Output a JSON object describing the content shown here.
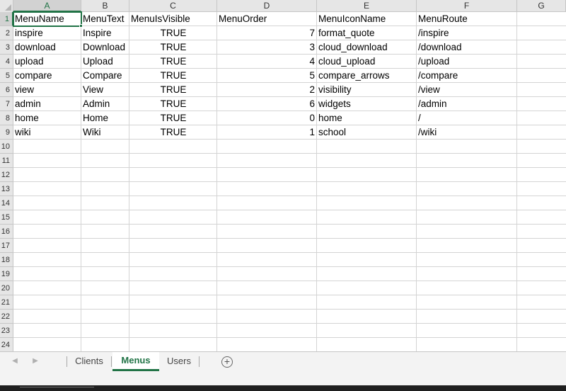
{
  "sheet": {
    "columns": [
      "A",
      "B",
      "C",
      "D",
      "E",
      "F",
      "G"
    ],
    "row_numbers": [
      "1",
      "2",
      "3",
      "4",
      "5",
      "6",
      "7",
      "8",
      "9",
      "10",
      "11",
      "12",
      "13",
      "14",
      "15",
      "16",
      "17",
      "18",
      "19",
      "20",
      "21",
      "22",
      "23",
      "24"
    ],
    "header_row": [
      "MenuName",
      "MenuText",
      "MenuIsVisible",
      "MenuOrder",
      "MenuIconName",
      "MenuRoute"
    ],
    "rows": [
      [
        "inspire",
        "Inspire",
        "TRUE",
        "7",
        "format_quote",
        "/inspire"
      ],
      [
        "download",
        "Download",
        "TRUE",
        "3",
        "cloud_download",
        "/download"
      ],
      [
        "upload",
        "Upload",
        "TRUE",
        "4",
        "cloud_upload",
        "/upload"
      ],
      [
        "compare",
        "Compare",
        "TRUE",
        "5",
        "compare_arrows",
        "/compare"
      ],
      [
        "view",
        "View",
        "TRUE",
        "2",
        "visibility",
        "/view"
      ],
      [
        "admin",
        "Admin",
        "TRUE",
        "6",
        "widgets",
        "/admin"
      ],
      [
        "home",
        "Home",
        "TRUE",
        "0",
        "home",
        "/"
      ],
      [
        "wiki",
        "Wiki",
        "TRUE",
        "1",
        "school",
        "/wiki"
      ]
    ],
    "selected_cell": "A1"
  },
  "tabs": {
    "items": [
      {
        "label": "Clients",
        "active": false
      },
      {
        "label": "Menus",
        "active": true
      },
      {
        "label": "Users",
        "active": false
      }
    ],
    "prev_icon": "triangle-left-icon",
    "next_icon": "triangle-right-icon",
    "add_icon": "plus-circle-icon",
    "add_glyph": "+"
  },
  "colors": {
    "accent": "#217346",
    "header_bg": "#e6e6e6",
    "gridline": "#d4d4d4"
  }
}
